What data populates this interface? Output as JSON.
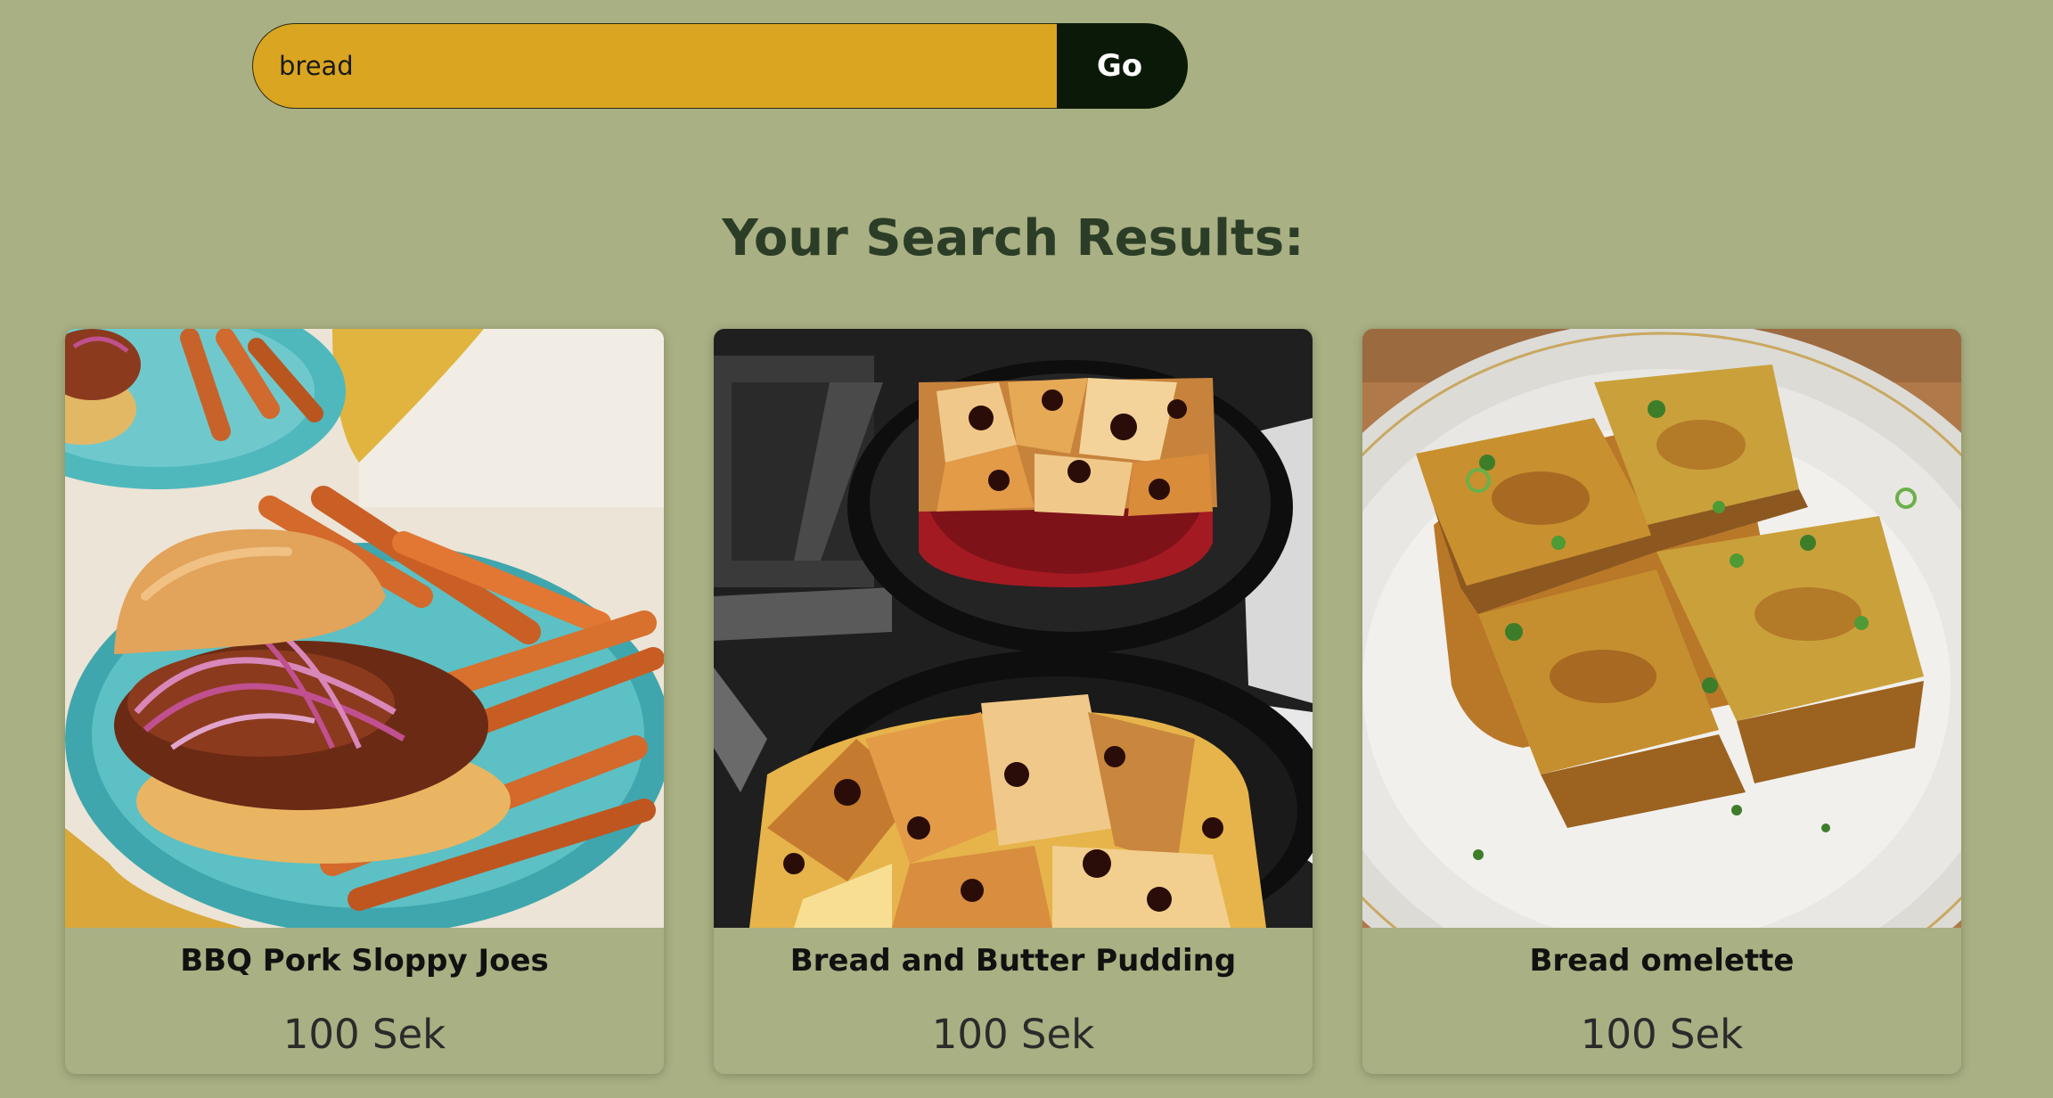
{
  "search": {
    "value": "bread",
    "button_label": "Go"
  },
  "results": {
    "heading": "Your Search Results:",
    "items": [
      {
        "title": "BBQ Pork Sloppy Joes",
        "price": "100 Sek",
        "image": "bbq-pork-sloppy-joes-photo"
      },
      {
        "title": "Bread and Butter Pudding",
        "price": "100 Sek",
        "image": "bread-and-butter-pudding-photo"
      },
      {
        "title": "Bread omelette",
        "price": "100 Sek",
        "image": "bread-omelette-photo"
      }
    ]
  },
  "colors": {
    "background": "#a9b083",
    "search_field": "#daa520",
    "go_button": "#0b1a08",
    "heading": "#2c3d27"
  }
}
